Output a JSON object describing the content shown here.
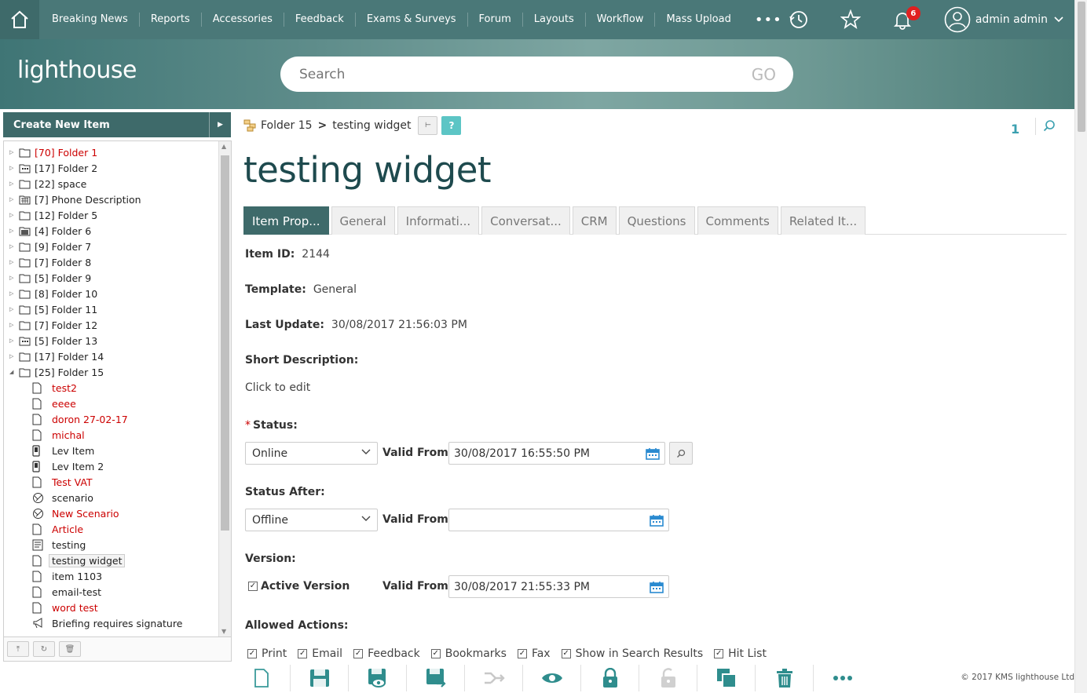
{
  "nav": {
    "items": [
      "Breaking News",
      "Reports",
      "Accessories",
      "Feedback",
      "Exams & Surveys",
      "Forum",
      "Layouts",
      "Workflow",
      "Mass Upload"
    ],
    "more": "•••",
    "notification_count": "6",
    "user_name": "admin admin"
  },
  "banner": {
    "logo_text": "lighthouse",
    "search_placeholder": "Search",
    "search_go": "GO"
  },
  "sidebar": {
    "create_label": "Create New Item",
    "folders": [
      {
        "label": "[70] Folder 1",
        "red": true,
        "icon": "folder-icon"
      },
      {
        "label": "[17] Folder 2",
        "red": false,
        "icon": "folder-dots-icon"
      },
      {
        "label": "[22] space",
        "red": false,
        "icon": "folder-icon"
      },
      {
        "label": "[7] Phone Description",
        "red": false,
        "icon": "folder-grid-icon"
      },
      {
        "label": "[12] Folder 5",
        "red": false,
        "icon": "folder-icon"
      },
      {
        "label": "[4] Folder 6",
        "red": false,
        "icon": "folder-calendar-icon"
      },
      {
        "label": "[9] Folder 7",
        "red": false,
        "icon": "folder-icon"
      },
      {
        "label": "[7] Folder 8",
        "red": false,
        "icon": "folder-icon"
      },
      {
        "label": "[5] Folder 9",
        "red": false,
        "icon": "folder-icon"
      },
      {
        "label": "[8] Folder 10",
        "red": false,
        "icon": "folder-icon"
      },
      {
        "label": "[5] Folder 11",
        "red": false,
        "icon": "folder-icon"
      },
      {
        "label": "[7] Folder 12",
        "red": false,
        "icon": "folder-icon"
      },
      {
        "label": "[5] Folder 13",
        "red": false,
        "icon": "folder-dots-icon"
      },
      {
        "label": "[17] Folder 14",
        "red": false,
        "icon": "folder-icon"
      },
      {
        "label": "[25] Folder 15",
        "red": false,
        "icon": "folder-icon",
        "expanded": true
      }
    ],
    "children": [
      {
        "label": "test2",
        "red": true,
        "icon": "document-icon"
      },
      {
        "label": "eeee",
        "red": true,
        "icon": "document-icon"
      },
      {
        "label": "doron 27-02-17",
        "red": true,
        "icon": "document-icon"
      },
      {
        "label": "michal",
        "red": true,
        "icon": "document-icon"
      },
      {
        "label": "Lev Item",
        "red": false,
        "icon": "phone-icon"
      },
      {
        "label": "Lev Item 2",
        "red": false,
        "icon": "phone-icon"
      },
      {
        "label": "Test VAT",
        "red": true,
        "icon": "document-icon"
      },
      {
        "label": "scenario",
        "red": false,
        "icon": "scenario-icon"
      },
      {
        "label": "New Scenario",
        "red": true,
        "icon": "scenario-icon"
      },
      {
        "label": "Article",
        "red": true,
        "icon": "document-icon"
      },
      {
        "label": "testing",
        "red": false,
        "icon": "article-icon"
      },
      {
        "label": "testing widget",
        "red": false,
        "icon": "document-icon",
        "selected": true
      },
      {
        "label": "item 1103",
        "red": false,
        "icon": "document-icon"
      },
      {
        "label": "email-test",
        "red": false,
        "icon": "document-icon"
      },
      {
        "label": "word test",
        "red": true,
        "icon": "document-icon"
      },
      {
        "label": "Briefing requires signature",
        "red": false,
        "icon": "megaphone-icon"
      }
    ]
  },
  "main": {
    "breadcrumb_folder": "Folder 15",
    "breadcrumb_item": "testing widget",
    "help_label": "?",
    "page_number": "1",
    "title": "testing widget",
    "tabs": [
      "Item Prop...",
      "General",
      "Informati...",
      "Conversat...",
      "CRM",
      "Questions",
      "Comments",
      "Related It..."
    ],
    "item_id_label": "Item ID:",
    "item_id": "2144",
    "template_label": "Template:",
    "template": "General",
    "last_update_label": "Last Update:",
    "last_update": "30/08/2017 21:56:03 PM",
    "short_desc_label": "Short Description:",
    "short_desc": "Click to edit",
    "required_mark": "*",
    "status_label": "Status:",
    "status_value": "Online",
    "valid_from_label": "Valid From:",
    "status_valid_from": "30/08/2017 16:55:50 PM",
    "status_after_label": "Status After:",
    "status_after_value": "Offline",
    "status_after_valid_from": "",
    "version_label": "Version:",
    "active_version_label": "Active Version",
    "version_valid_from": "30/08/2017 21:55:33 PM",
    "allowed_label": "Allowed Actions:",
    "allowed_actions": [
      "Print",
      "Email",
      "Feedback",
      "Bookmarks",
      "Fax",
      "Show in Search Results",
      "Hit List"
    ]
  },
  "footer": {
    "copyright": "© 2017 KMS lighthouse Ltd"
  },
  "colors": {
    "nav_bg": "#4a7878",
    "accent": "#3e6a6a",
    "title": "#1e4a4e",
    "red_item": "#cc0000",
    "cal_blue": "#2a8ad0"
  }
}
